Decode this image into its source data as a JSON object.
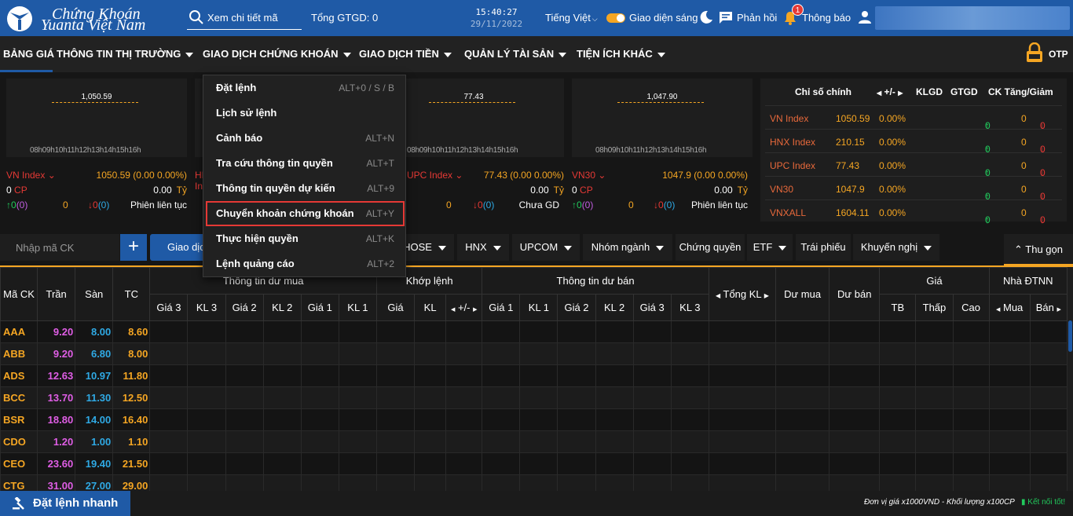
{
  "header": {
    "logo_line1": "Chứng Khoán",
    "logo_line2": "Yuanta Việt Nam",
    "search_placeholder": "Xem chi tiết mã",
    "total_gtgd": "Tổng GTGD: 0",
    "time": "15:40:27",
    "date": "29/11/2022",
    "language": "Tiếng Việt",
    "theme_label": "Giao diện sáng",
    "feedback_label": "Phản hồi",
    "notification_label": "Thông báo",
    "notification_count": "1"
  },
  "menu": {
    "items": [
      "BẢNG GIÁ",
      "THÔNG TIN THỊ TRƯỜNG",
      "GIAO DỊCH CHỨNG KHOÁN",
      "GIAO DỊCH TIỀN",
      "QUẢN LÝ TÀI SẢN",
      "TIỆN ÍCH KHÁC"
    ],
    "otp_label": "OTP"
  },
  "dropdown": {
    "items": [
      {
        "label": "Đặt lệnh",
        "shortcut": "ALT+0 / S / B"
      },
      {
        "label": "Lịch sử lệnh",
        "shortcut": ""
      },
      {
        "label": "Cảnh báo",
        "shortcut": "ALT+N"
      },
      {
        "label": "Tra cứu thông tin quyền",
        "shortcut": "ALT+T"
      },
      {
        "label": "Thông tin quyền dự kiến",
        "shortcut": "ALT+9"
      },
      {
        "label": "Chuyển khoản chứng khoán",
        "shortcut": "ALT+Y"
      },
      {
        "label": "Thực hiện quyền",
        "shortcut": "ALT+K"
      },
      {
        "label": "Lệnh quảng cáo",
        "shortcut": "ALT+2"
      }
    ]
  },
  "sparklines": [
    {
      "value": "1,050.59",
      "hours": "08h09h10h11h12h13h14h15h16h"
    },
    {
      "value": "",
      "hours": ""
    },
    {
      "value": "77.43",
      "hours": "08h09h10h11h12h13h14h15h16h"
    },
    {
      "value": "1,047.90",
      "hours": "08h09h10h11h12h13h14h15h16h"
    }
  ],
  "index_boxes": [
    {
      "name": "VN Index",
      "price": "1050.59",
      "change": "(0.00 0.00%)",
      "cp": "0",
      "cp_label": "CP",
      "value": "0.00",
      "unit": "Tỷ",
      "up": "0",
      "ref": "(0)",
      "mid": "0",
      "down": "0",
      "down_ref": "(0)",
      "session": "Phiên liên tục"
    },
    {
      "name": "HNX Index",
      "price": "",
      "change": "",
      "cp": "",
      "cp_label": "",
      "value": "",
      "unit": "",
      "up": "",
      "ref": "",
      "mid": "",
      "down": "",
      "down_ref": "",
      "session": ""
    },
    {
      "name": "UPC Index",
      "price": "77.43",
      "change": "(0.00 0.00%)",
      "cp": "",
      "cp_label": "",
      "value": "0.00",
      "unit": "Tỷ",
      "up": "",
      "ref": "",
      "mid": "0",
      "down": "0",
      "down_ref": "(0)",
      "session": "Chưa GD"
    },
    {
      "name": "VN30",
      "price": "1047.9",
      "change": "(0.00 0.00%)",
      "cp": "0",
      "cp_label": "CP",
      "value": "0.00",
      "unit": "Tỷ",
      "up": "0",
      "ref": "(0)",
      "mid": "0",
      "down": "0",
      "down_ref": "(0)",
      "session": "Phiên liên tục"
    }
  ],
  "index_table": {
    "headers": [
      "Chỉ số chính",
      "+/-",
      "KLGD",
      "GTGD",
      "CK Tăng/Giảm"
    ],
    "rows": [
      {
        "name": "VN Index",
        "value": "1050.59",
        "pct": "0.00%",
        "up": "0",
        "mid": "0",
        "down": "0"
      },
      {
        "name": "HNX Index",
        "value": "210.15",
        "pct": "0.00%",
        "up": "0",
        "mid": "0",
        "down": "0"
      },
      {
        "name": "UPC Index",
        "value": "77.43",
        "pct": "0.00%",
        "up": "0",
        "mid": "0",
        "down": "0"
      },
      {
        "name": "VN30",
        "value": "1047.9",
        "pct": "0.00%",
        "up": "0",
        "mid": "0",
        "down": "0"
      },
      {
        "name": "VNXALL",
        "value": "1604.11",
        "pct": "0.00%",
        "up": "0",
        "mid": "0",
        "down": "0"
      }
    ]
  },
  "filters": {
    "code_placeholder": "Nhập mã CK",
    "trade_button": "Giao dịch",
    "tabs": [
      {
        "label": "HOSE",
        "caret": true
      },
      {
        "label": "HNX",
        "caret": true
      },
      {
        "label": "UPCOM",
        "caret": true
      },
      {
        "label": "Nhóm ngành",
        "caret": true
      },
      {
        "label": "Chứng quyền",
        "caret": false
      },
      {
        "label": "ETF",
        "caret": true
      },
      {
        "label": "Trái phiếu",
        "caret": false
      },
      {
        "label": "Khuyến nghị",
        "caret": true
      }
    ],
    "collapse_label": "Thu gọn"
  },
  "grid": {
    "group_headers": {
      "buy": "Thông tin dư mua",
      "match": "Khớp lệnh",
      "sell": "Thông tin dư bán",
      "price": "Giá",
      "foreign": "Nhà ĐTNN"
    },
    "single_headers": {
      "symbol": "Mã CK",
      "ceiling": "Trần",
      "floor": "Sàn",
      "ref": "TC",
      "total_vol": "Tổng KL",
      "bid_rem": "Dư mua",
      "ask_rem": "Dư bán"
    },
    "sub_headers": {
      "buy": [
        "Giá 3",
        "KL 3",
        "Giá 2",
        "KL 2",
        "Giá 1",
        "KL 1"
      ],
      "match": [
        "Giá",
        "KL",
        "+/-"
      ],
      "sell": [
        "Giá 1",
        "KL 1",
        "Giá 2",
        "KL 2",
        "Giá 3",
        "KL 3"
      ],
      "price": [
        "TB",
        "Thấp",
        "Cao"
      ],
      "foreign": [
        "Mua",
        "Bán"
      ]
    },
    "rows": [
      {
        "symbol": "AAA",
        "ceiling": "9.20",
        "floor": "8.00",
        "ref": "8.60"
      },
      {
        "symbol": "ABB",
        "ceiling": "9.20",
        "floor": "6.80",
        "ref": "8.00"
      },
      {
        "symbol": "ADS",
        "ceiling": "12.63",
        "floor": "10.97",
        "ref": "11.80"
      },
      {
        "symbol": "BCC",
        "ceiling": "13.70",
        "floor": "11.30",
        "ref": "12.50"
      },
      {
        "symbol": "BSR",
        "ceiling": "18.80",
        "floor": "14.00",
        "ref": "16.40"
      },
      {
        "symbol": "CDO",
        "ceiling": "1.20",
        "floor": "1.00",
        "ref": "1.10"
      },
      {
        "symbol": "CEO",
        "ceiling": "23.60",
        "floor": "19.40",
        "ref": "21.50"
      },
      {
        "symbol": "CTG",
        "ceiling": "31.00",
        "floor": "27.00",
        "ref": "29.00"
      }
    ]
  },
  "footer": {
    "quick_order": "Đặt lệnh nhanh",
    "unit_note": "Đơn vị giá x1000VND - Khối lượng x100CP",
    "connection": "Kết nối tốt!"
  },
  "colors": {
    "primary": "#1f5aa6",
    "accent": "#f5a623",
    "up": "#21c95c",
    "down": "#e53935",
    "ceiling": "#e05ee6",
    "floor": "#2fa9e4"
  }
}
